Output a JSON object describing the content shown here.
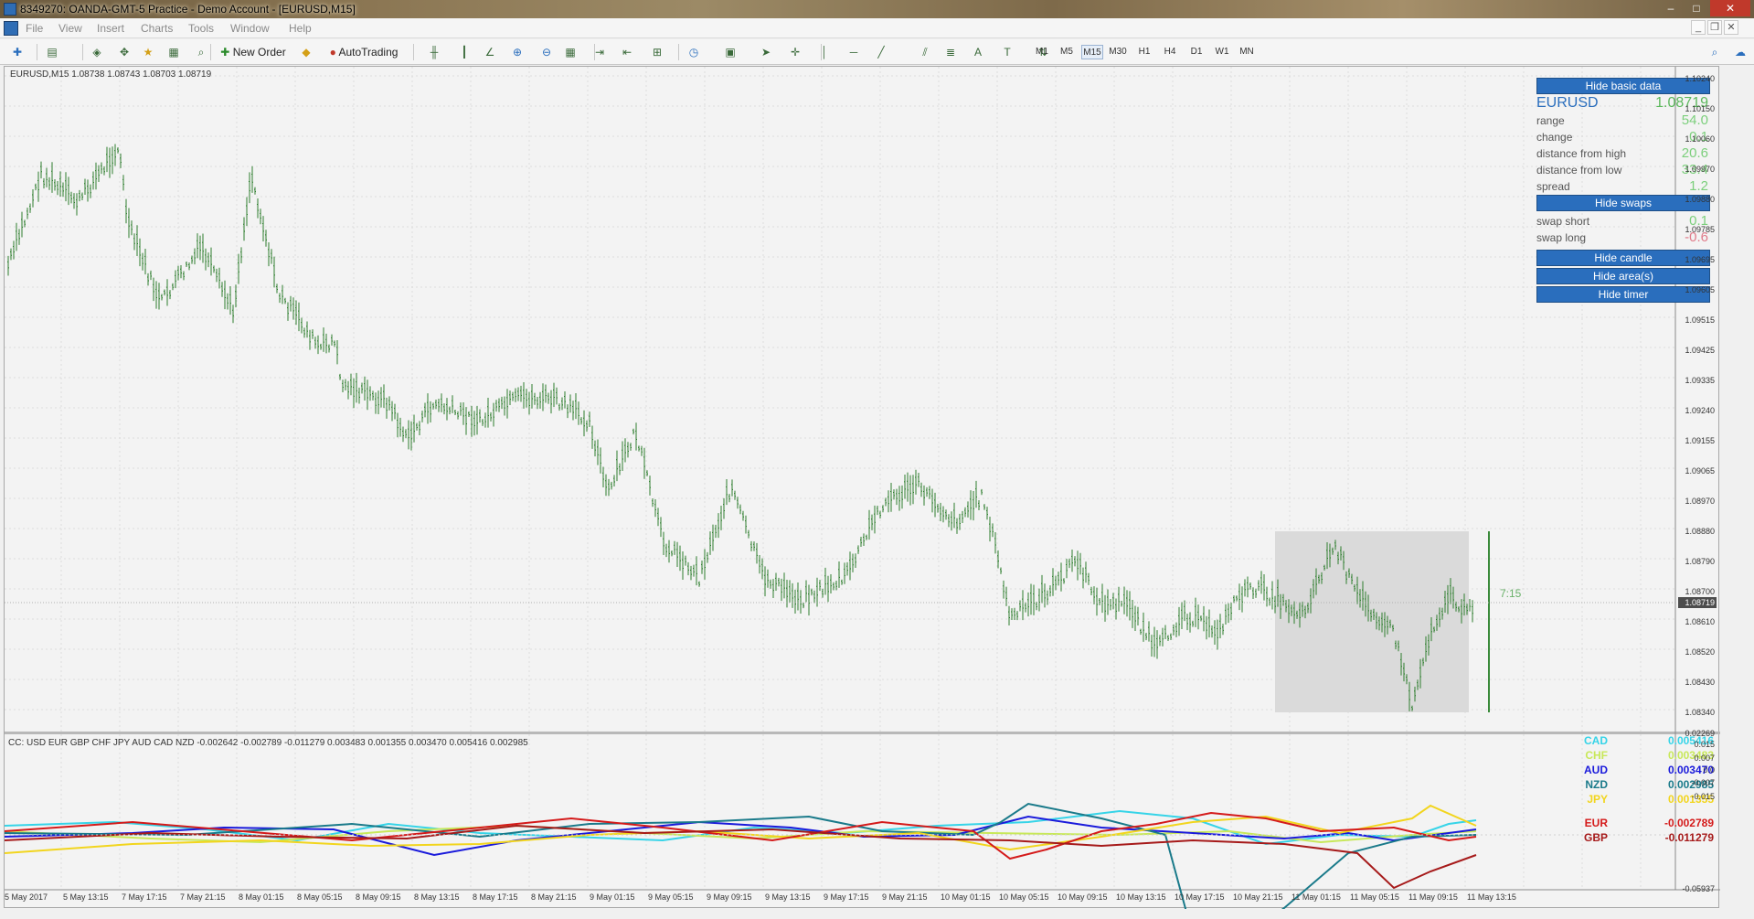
{
  "window": {
    "title": "8349270: OANDA-GMT-5 Practice - Demo Account - [EURUSD,M15]",
    "min": "–",
    "max": "□",
    "close": "✕"
  },
  "menu": [
    "File",
    "View",
    "Insert",
    "Charts",
    "Tools",
    "Window",
    "Help"
  ],
  "toolbar": {
    "new_order": "New Order",
    "autotrading": "AutoTrading",
    "timeframes": [
      "M1",
      "M5",
      "M15",
      "M30",
      "H1",
      "H4",
      "D1",
      "W1",
      "MN"
    ],
    "active_tf": "M15",
    "tool_icons": [
      "new-chart-icon",
      "profiles-icon",
      "market-watch-icon",
      "navigator-icon",
      "favorites-icon",
      "data-window-icon",
      "strategy-tester-icon",
      "bar-chart-icon",
      "candles-icon",
      "line-chart-icon",
      "zoom-in-icon",
      "zoom-out-icon",
      "tile-icon",
      "autoscroll-icon",
      "chart-shift-icon",
      "indicators-icon",
      "periods-icon",
      "templates-icon",
      "cursor-icon",
      "crosshair-icon",
      "vertical-line-icon",
      "horizontal-line-icon",
      "trendline-icon",
      "equidistant-channel-icon",
      "fibonacci-icon",
      "text-icon",
      "text-label-icon",
      "arrows-icon",
      "search-icon",
      "chat-icon"
    ]
  },
  "chart": {
    "header": "EURUSD,M15  1.08738 1.08743 1.08703 1.08719",
    "timer": "7:15",
    "price_label": "1.08719",
    "y_ticks": [
      "1.10240",
      "1.10150",
      "1.10060",
      "1.09970",
      "1.09880",
      "1.09785",
      "1.09695",
      "1.09605",
      "1.09515",
      "1.09425",
      "1.09335",
      "1.09240",
      "1.09155",
      "1.09065",
      "1.08970",
      "1.08880",
      "1.08790",
      "1.08700",
      "1.08610",
      "1.08520",
      "1.08430",
      "1.08340"
    ],
    "x_ticks": [
      "5 May 2017",
      "5 May 13:15",
      "7 May 17:15",
      "7 May 21:15",
      "8 May 01:15",
      "8 May 05:15",
      "8 May 09:15",
      "8 May 13:15",
      "8 May 17:15",
      "8 May 21:15",
      "9 May 01:15",
      "9 May 05:15",
      "9 May 09:15",
      "9 May 13:15",
      "9 May 17:15",
      "9 May 21:15",
      "10 May 01:15",
      "10 May 05:15",
      "10 May 09:15",
      "10 May 13:15",
      "10 May 17:15",
      "10 May 21:15",
      "11 May 01:15",
      "11 May 05:15",
      "11 May 09:15",
      "11 May 13:15"
    ]
  },
  "info_panel": {
    "hide_basic": "Hide basic data",
    "symbol": "EURUSD",
    "price": "1.08719",
    "rows": [
      {
        "label": "range",
        "value": "54.0"
      },
      {
        "label": "change",
        "value": "0.1"
      },
      {
        "label": "distance from high",
        "value": "20.6"
      },
      {
        "label": "distance from low",
        "value": "33.4"
      },
      {
        "label": "spread",
        "value": "1.2"
      }
    ],
    "hide_swaps": "Hide swaps",
    "swaps": [
      {
        "label": "swap short",
        "value": "0.1",
        "color": "#7ccf7c"
      },
      {
        "label": "swap long",
        "value": "-0.6",
        "color": "#e07b8a"
      }
    ],
    "hide_candle": "Hide candle",
    "hide_areas": "Hide area(s)",
    "hide_timer": "Hide timer"
  },
  "indicator": {
    "header": "CC:  USD EUR GBP CHF JPY AUD CAD NZD -0.002642 -0.002789 -0.011279 0.003483 0.001355 0.003470 0.005416 0.002985",
    "y_ticks": [
      "0.02269",
      "0.015",
      "0.007",
      "0.0",
      "-0.007",
      "-0.015",
      "-0.05937"
    ],
    "legend": [
      {
        "cur": "CAD",
        "val": "0.005416",
        "color": "#36d4e8"
      },
      {
        "cur": "CHF",
        "val": "0.003483",
        "color": "#c8e85a"
      },
      {
        "cur": "AUD",
        "val": "0.003470",
        "color": "#1a1adb"
      },
      {
        "cur": "NZD",
        "val": "0.002985",
        "color": "#1a7a8a"
      },
      {
        "cur": "JPY",
        "val": "0.001355",
        "color": "#f2d51e"
      },
      {
        "cur": "EUR",
        "val": "-0.002789",
        "color": "#d41a1a"
      },
      {
        "cur": "GBP",
        "val": "-0.011279",
        "color": "#a61a1a"
      }
    ]
  }
}
